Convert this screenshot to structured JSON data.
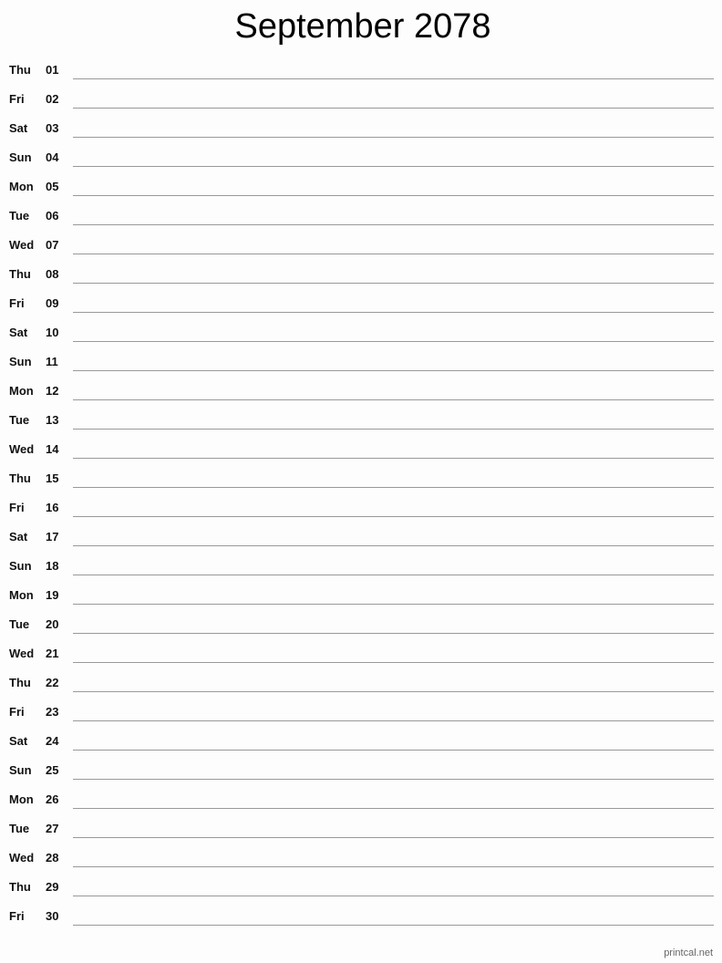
{
  "title": "September 2078",
  "days": [
    {
      "dow": "Thu",
      "day": "01"
    },
    {
      "dow": "Fri",
      "day": "02"
    },
    {
      "dow": "Sat",
      "day": "03"
    },
    {
      "dow": "Sun",
      "day": "04"
    },
    {
      "dow": "Mon",
      "day": "05"
    },
    {
      "dow": "Tue",
      "day": "06"
    },
    {
      "dow": "Wed",
      "day": "07"
    },
    {
      "dow": "Thu",
      "day": "08"
    },
    {
      "dow": "Fri",
      "day": "09"
    },
    {
      "dow": "Sat",
      "day": "10"
    },
    {
      "dow": "Sun",
      "day": "11"
    },
    {
      "dow": "Mon",
      "day": "12"
    },
    {
      "dow": "Tue",
      "day": "13"
    },
    {
      "dow": "Wed",
      "day": "14"
    },
    {
      "dow": "Thu",
      "day": "15"
    },
    {
      "dow": "Fri",
      "day": "16"
    },
    {
      "dow": "Sat",
      "day": "17"
    },
    {
      "dow": "Sun",
      "day": "18"
    },
    {
      "dow": "Mon",
      "day": "19"
    },
    {
      "dow": "Tue",
      "day": "20"
    },
    {
      "dow": "Wed",
      "day": "21"
    },
    {
      "dow": "Thu",
      "day": "22"
    },
    {
      "dow": "Fri",
      "day": "23"
    },
    {
      "dow": "Sat",
      "day": "24"
    },
    {
      "dow": "Sun",
      "day": "25"
    },
    {
      "dow": "Mon",
      "day": "26"
    },
    {
      "dow": "Tue",
      "day": "27"
    },
    {
      "dow": "Wed",
      "day": "28"
    },
    {
      "dow": "Thu",
      "day": "29"
    },
    {
      "dow": "Fri",
      "day": "30"
    }
  ],
  "footer": "printcal.net"
}
